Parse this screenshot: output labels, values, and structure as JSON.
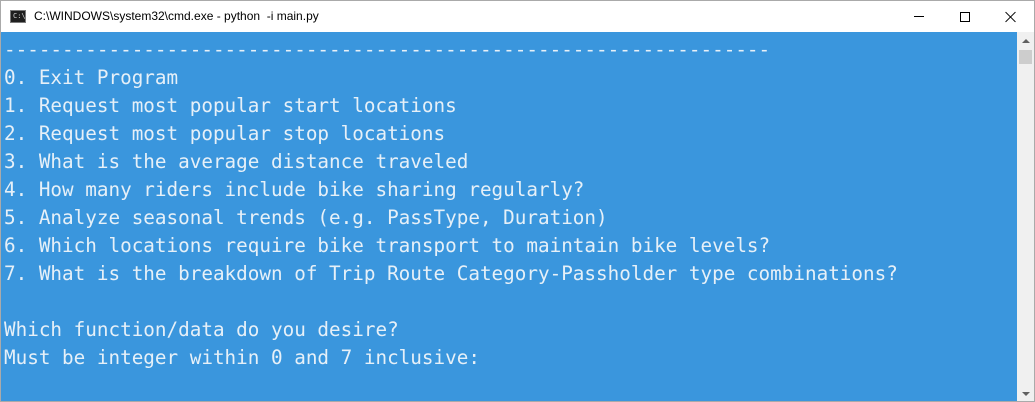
{
  "window": {
    "title": "C:\\WINDOWS\\system32\\cmd.exe - python  -i main.py",
    "icon": "cmd-prompt-icon",
    "icon_glyph": "C:\\",
    "controls": {
      "minimize": "minimize-icon",
      "maximize": "maximize-icon",
      "close": "close-icon"
    }
  },
  "console": {
    "background": "#3a96dd",
    "foreground": "#e6f0f8",
    "lines": [
      "------------------------------------------------------------------",
      "0. Exit Program",
      "1. Request most popular start locations",
      "2. Request most popular stop locations",
      "3. What is the average distance traveled",
      "4. How many riders include bike sharing regularly?",
      "5. Analyze seasonal trends (e.g. PassType, Duration)",
      "6. Which locations require bike transport to maintain bike levels?",
      "7. What is the breakdown of Trip Route Category-Passholder type combinations?",
      "",
      "Which function/data do you desire?",
      "Must be integer within 0 and 7 inclusive:"
    ]
  },
  "scrollbar": {
    "up": "scroll-up-arrow-icon",
    "down": "scroll-down-arrow-icon"
  }
}
